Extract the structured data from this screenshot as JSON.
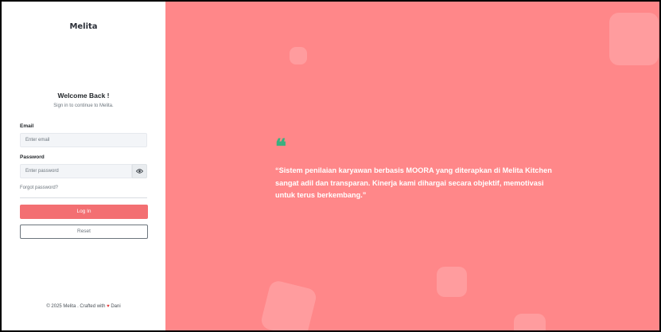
{
  "brand": "Melita",
  "login": {
    "title": "Welcome Back !",
    "subtitle": "Sign in to continue to Melita.",
    "email_label": "Email",
    "email_placeholder": "Enter email",
    "password_label": "Password",
    "password_placeholder": "Enter password",
    "forgot": "Forgot password?",
    "login_button": "Log In",
    "reset_button": "Reset"
  },
  "footer": {
    "prefix": "© 2025 Melita . Crafted with",
    "heart": "♥",
    "author": "Dani"
  },
  "testimonial": {
    "quote_mark": "❝",
    "text": "“Sistem penilaian karyawan berbasis MOORA yang diterapkan di Melita Kitchen sangat adil dan transparan. Kinerja kami dihargai secara objektif, memotivasi untuk terus berkembang.”"
  },
  "colors": {
    "accent": "#f36f72",
    "panel_bg": "#ff8789",
    "quote_icon": "#3ab07f"
  },
  "icons": {
    "password_toggle": "eye-icon",
    "heart": "heart-icon",
    "quote": "quote-icon"
  }
}
